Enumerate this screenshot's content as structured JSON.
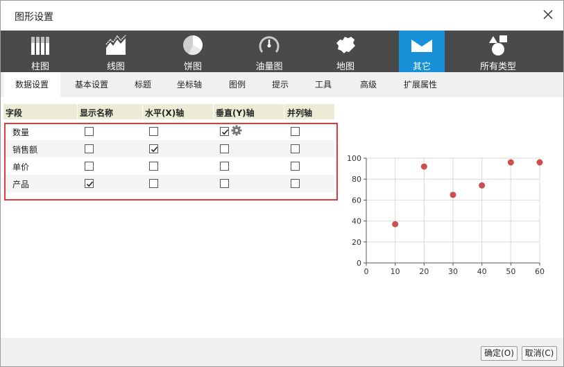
{
  "dialog": {
    "title": "图形设置"
  },
  "ribbon": {
    "tabs": [
      {
        "label": "柱图",
        "icon": "bar-chart-icon"
      },
      {
        "label": "线图",
        "icon": "line-chart-icon"
      },
      {
        "label": "饼图",
        "icon": "pie-chart-icon"
      },
      {
        "label": "油量图",
        "icon": "gauge-icon"
      },
      {
        "label": "地图",
        "icon": "map-icon"
      },
      {
        "label": "其它",
        "icon": "other-chart-icon",
        "active": true
      },
      {
        "label": "所有类型",
        "icon": "shapes-icon"
      }
    ]
  },
  "subtabs": [
    "数据设置",
    "基本设置",
    "标题",
    "坐标轴",
    "图例",
    "提示",
    "工具",
    "高级",
    "扩展属性"
  ],
  "grid": {
    "headers": [
      "字段",
      "显示名称",
      "水平(X)轴",
      "垂直(Y)轴",
      "并列轴"
    ],
    "rows": [
      {
        "field": "数量",
        "show_name": false,
        "x_axis": false,
        "y_axis": true,
        "parallel": false,
        "y_gear": true
      },
      {
        "field": "销售额",
        "show_name": false,
        "x_axis": true,
        "y_axis": false,
        "parallel": false
      },
      {
        "field": "单价",
        "show_name": false,
        "x_axis": false,
        "y_axis": false,
        "parallel": false
      },
      {
        "field": "产品",
        "show_name": true,
        "x_axis": false,
        "y_axis": false,
        "parallel": false
      }
    ]
  },
  "chart_data": {
    "type": "scatter",
    "x": [
      10,
      20,
      30,
      40,
      50,
      60
    ],
    "y": [
      37,
      92,
      65,
      74,
      96,
      96
    ],
    "xlim": [
      0,
      60
    ],
    "ylim": [
      0,
      100
    ],
    "xticks": [
      "0",
      "10",
      "20",
      "30",
      "40",
      "50",
      "60"
    ],
    "yticks": [
      "0",
      "20",
      "40",
      "60",
      "80",
      "100"
    ],
    "grid": true,
    "color": "#c9504f"
  },
  "footer": {
    "ok_label": "确定(O)",
    "cancel_label": "取消(C)"
  },
  "colors": {
    "ribbon_bg": "#4a4a4a",
    "active_tab": "#1890d8",
    "highlight_border": "#e03a3a"
  }
}
